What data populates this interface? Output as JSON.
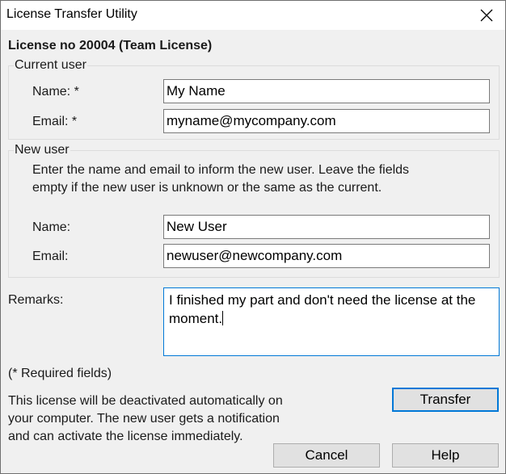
{
  "window": {
    "title": "License Transfer Utility",
    "close_icon": "close-icon"
  },
  "license": {
    "heading": "License no 20004 (Team License)"
  },
  "current_user": {
    "legend": "Current user",
    "name_label": "Name: *",
    "name_value": "My Name",
    "email_label": "Email: *",
    "email_value": "myname@mycompany.com"
  },
  "new_user": {
    "legend": "New user",
    "description_line1": "Enter the name and email to inform the new user. Leave the fields",
    "description_line2": "empty if the new user is unknown or the same as the current.",
    "name_label": "Name:",
    "name_value": "New User",
    "email_label": "Email:",
    "email_value": "newuser@newcompany.com"
  },
  "remarks": {
    "label": "Remarks:",
    "line1": "I finished my part and don't need the license at the",
    "line2": "moment."
  },
  "footer": {
    "required_note": "(*  Required fields)",
    "info_line1": "This license will be deactivated automatically on",
    "info_line2": "your computer. The new user gets a notification",
    "info_line3": "and can activate the license immediately."
  },
  "buttons": {
    "transfer": "Transfer",
    "cancel": "Cancel",
    "help": "Help"
  },
  "colors": {
    "focus_accent": "#0078d7",
    "dialog_bg": "#f0f0f0"
  }
}
